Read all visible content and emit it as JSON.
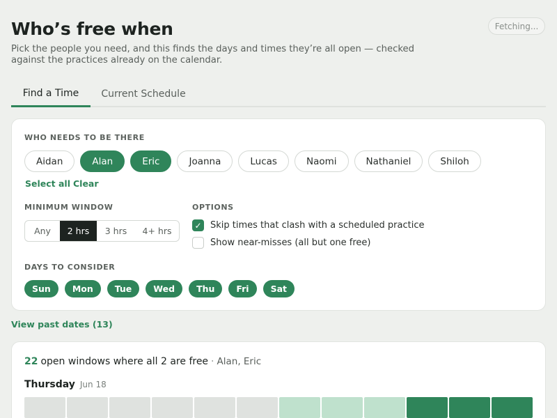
{
  "header": {
    "title": "Who’s free when",
    "subtitle": "Pick the people you need, and this finds the days and times they’re all open — checked against the practices already on the calendar.",
    "status": "Fetching..."
  },
  "tabs": [
    {
      "label": "Find a Time",
      "active": true
    },
    {
      "label": "Current Schedule",
      "active": false
    }
  ],
  "people": {
    "label": "WHO NEEDS TO BE THERE",
    "items": [
      {
        "name": "Aidan",
        "selected": false
      },
      {
        "name": "Alan",
        "selected": true
      },
      {
        "name": "Eric",
        "selected": true
      },
      {
        "name": "Joanna",
        "selected": false
      },
      {
        "name": "Lucas",
        "selected": false
      },
      {
        "name": "Naomi",
        "selected": false
      },
      {
        "name": "Nathaniel",
        "selected": false
      },
      {
        "name": "Shiloh",
        "selected": false
      }
    ],
    "select_all": "Select all",
    "clear": "Clear"
  },
  "min_window": {
    "label": "MINIMUM WINDOW",
    "options": [
      "Any",
      "2 hrs",
      "3 hrs",
      "4+ hrs"
    ],
    "selected": "2 hrs"
  },
  "options": {
    "label": "OPTIONS",
    "skip_clashes": {
      "label": "Skip times that clash with a scheduled practice",
      "checked": true
    },
    "near_misses": {
      "label": "Show near-misses (all but one free)",
      "checked": false
    }
  },
  "days": {
    "label": "DAYS TO CONSIDER",
    "items": [
      "Sun",
      "Mon",
      "Tue",
      "Wed",
      "Thu",
      "Fri",
      "Sat"
    ]
  },
  "past_dates_link": "View past dates (13)",
  "results": {
    "count": "22",
    "summary": "open windows where all 2 are free",
    "separator": "·",
    "names": "Alan, Eric",
    "day_name": "Thursday",
    "day_date": "Jun 18",
    "slot_levels": [
      "none",
      "none",
      "none",
      "none",
      "none",
      "none",
      "partial",
      "partial",
      "partial",
      "full",
      "full",
      "full"
    ]
  },
  "colors": {
    "accent": "#2f855a",
    "partial": "#bfe1cd",
    "empty": "#dfe2df",
    "dark": "#1d2320"
  }
}
